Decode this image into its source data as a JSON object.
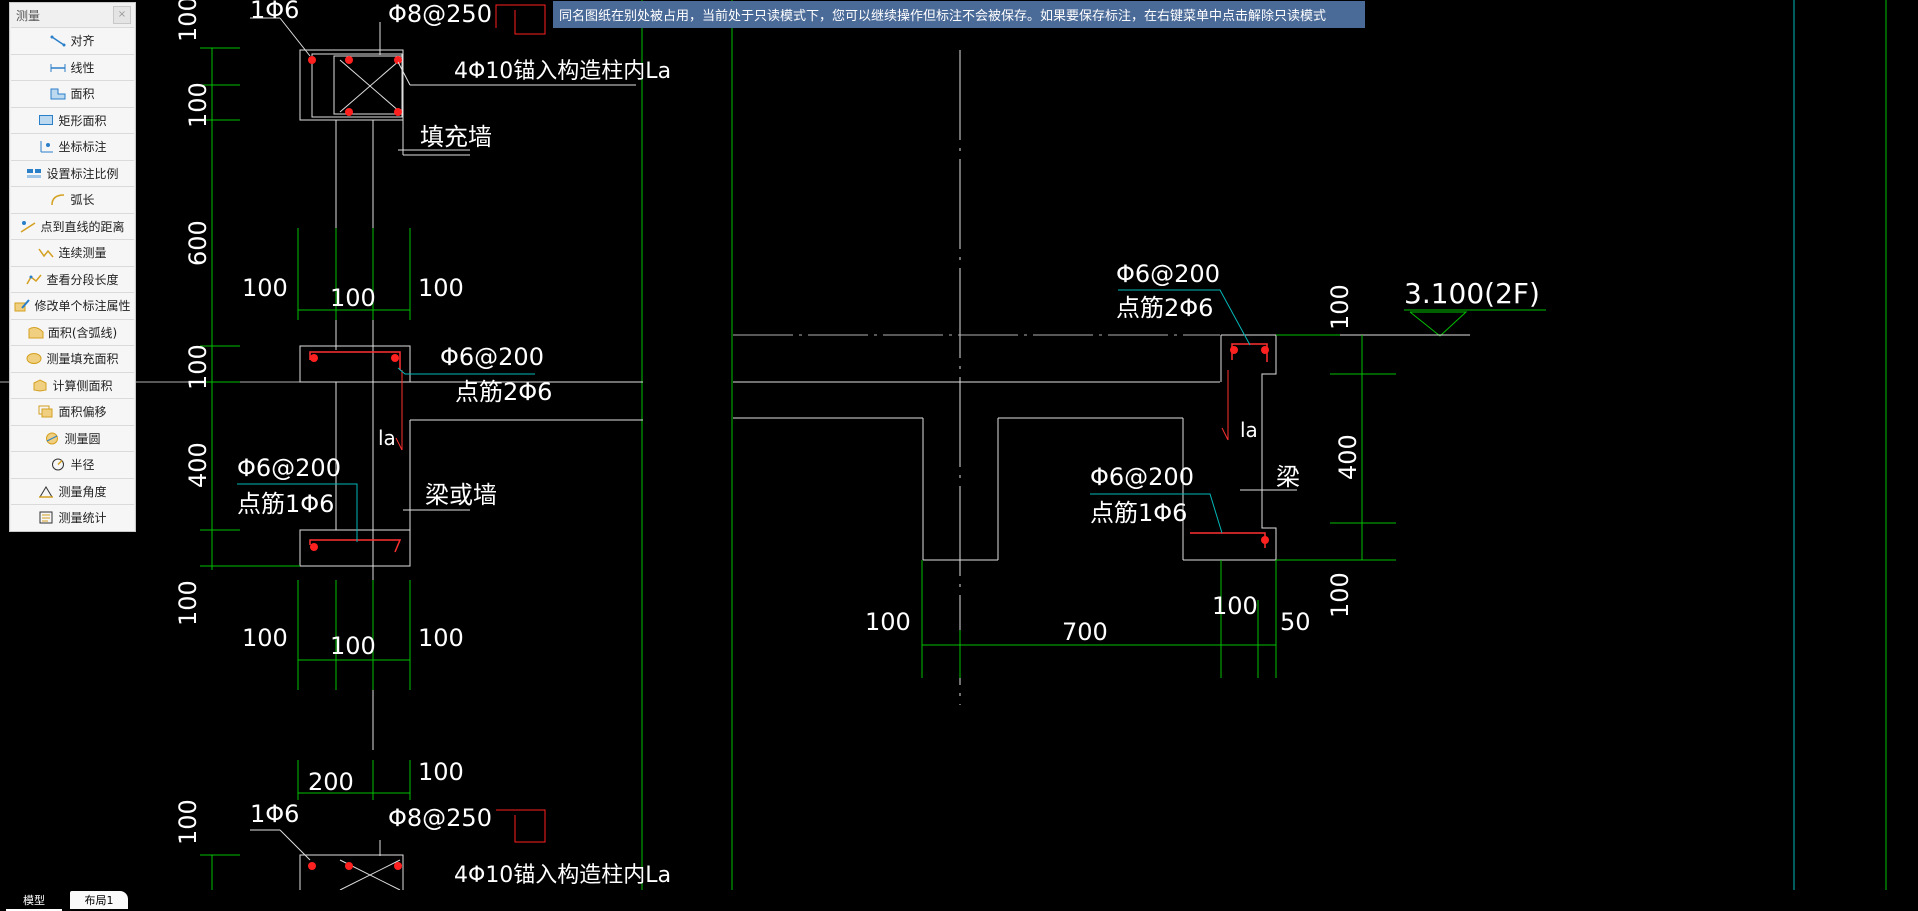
{
  "panel": {
    "title": "测量",
    "close_symbol": "×",
    "tools": [
      {
        "label": "对齐",
        "icon": "aligned-dimension-icon"
      },
      {
        "label": "线性",
        "icon": "linear-dimension-icon"
      },
      {
        "label": "面积",
        "icon": "area-icon"
      },
      {
        "label": "矩形面积",
        "icon": "rectangle-area-icon"
      },
      {
        "label": "坐标标注",
        "icon": "coordinate-icon"
      },
      {
        "label": "设置标注比例",
        "icon": "scale-icon"
      },
      {
        "label": "弧长",
        "icon": "arc-length-icon"
      },
      {
        "label": "点到直线的距离",
        "icon": "point-to-line-icon"
      },
      {
        "label": "连续测量",
        "icon": "continuous-measure-icon"
      },
      {
        "label": "查看分段长度",
        "icon": "segment-length-icon"
      },
      {
        "label": "修改单个标注属性",
        "icon": "edit-dimension-icon"
      },
      {
        "label": "面积(含弧线)",
        "icon": "arc-area-icon"
      },
      {
        "label": "测量填充面积",
        "icon": "fill-area-icon"
      },
      {
        "label": "计算侧面积",
        "icon": "side-area-icon"
      },
      {
        "label": "面积偏移",
        "icon": "area-offset-icon"
      },
      {
        "label": "测量圆",
        "icon": "circle-measure-icon"
      },
      {
        "label": "半径",
        "icon": "radius-icon"
      },
      {
        "label": "测量角度",
        "icon": "angle-icon"
      },
      {
        "label": "测量统计",
        "icon": "statistics-icon"
      }
    ]
  },
  "notice": "同名图纸在别处被占用，当前处于只读模式下，您可以继续操作但标注不会被保存。如果要保存标注，在右键菜单中点击解除只读模式",
  "tabs": [
    "模型",
    "布局1"
  ],
  "drawing": {
    "texts_left": {
      "top_rebar": "1Φ6",
      "top_stirrup": "Φ8@250",
      "anchor_note": "4Φ10锚入构造柱内La",
      "infill_wall": "填充墙",
      "dim_100_a": "100",
      "dim_100_b": "100",
      "dim_600": "600",
      "dim_100_c": "100",
      "dim_400": "400",
      "dim_100_d": "100",
      "row1_100_left": "100",
      "row1_100_mid": "100",
      "row1_100_right": "100",
      "stirrup_mid": "Φ6@200",
      "point_bar_2": "点筋2Φ6",
      "la_left": "la",
      "stirrup_low": "Φ6@200",
      "point_bar_1": "点筋1Φ6",
      "beam_or_wall": "梁或墙",
      "row2_100_left": "100",
      "row2_100_mid": "100",
      "row2_100_right": "100",
      "dim_200": "200",
      "dim_100_top_b": "100",
      "bottom_dim_100": "100",
      "bottom_rebar": "1Φ6",
      "bottom_stirrup": "Φ8@250",
      "bottom_anchor_note": "4Φ10锚入构造柱内La"
    },
    "texts_right": {
      "stirrup_top": "Φ6@200",
      "point_bar_2": "点筋2Φ6",
      "elevation": "3.100(2F)",
      "dim_100_top": "100",
      "la_right": "la",
      "dim_400": "400",
      "beam": "梁",
      "stirrup_low": "Φ6@200",
      "point_bar_1": "点筋1Φ6",
      "dim_100_bottom": "100",
      "dim_100_left": "100",
      "dim_700": "700",
      "dim_100_mid": "100",
      "dim_50": "50"
    }
  }
}
